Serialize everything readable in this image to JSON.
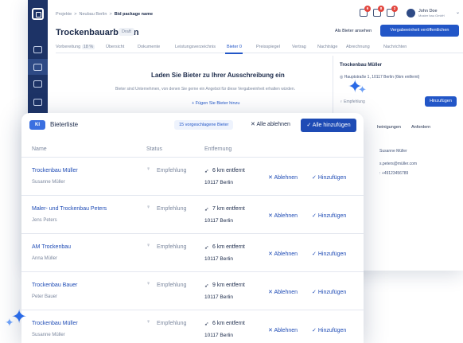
{
  "breadcrumb": {
    "root": "Projekte",
    "project": "Neubau Berlin",
    "current": "Bid package name",
    "sep": ">"
  },
  "page": {
    "title": "Trockenbauarbeiten",
    "status": "Draft"
  },
  "header": {
    "badges": [
      "6",
      "8",
      "2"
    ],
    "user_name": "John Doe",
    "user_company": "Muster bau GmbH",
    "view_as_bidder": "Als Bieter ansehen",
    "publish": "Vergabeeinheit veröffentlichen"
  },
  "tabs": [
    {
      "label": "Vorbereitung",
      "extra": "18 %"
    },
    {
      "label": "Übersicht"
    },
    {
      "label": "Dokumente"
    },
    {
      "label": "Leistungsverzeichnis"
    },
    {
      "label": "Bieter",
      "extra": "0",
      "active": true
    },
    {
      "label": "Preisspiegel"
    },
    {
      "label": "Vertrag"
    },
    {
      "label": "Nachträge"
    },
    {
      "label": "Abrechnung"
    },
    {
      "label": "Nachrichten"
    }
  ],
  "empty_state": {
    "title": "Laden Sie Bieter zu Ihrer Ausschreibung ein",
    "description": "Bieter sind Unternehmen, von denen Sie gerne ein Angebot für diese Vergabeeinheit erhalten würden.",
    "add_link": "+ Fügen Sie Bieter hinzu"
  },
  "side_panel": {
    "name": "Trockenbau Müller",
    "address": "Hauptstraße 1, 10117 Berlin (6km entfernt)",
    "recommendation": "Empfehlung",
    "add": "Hinzufügen",
    "tab_certificates": "heinigungen",
    "tab_request": "Anfordern",
    "contact_name": "Susanne Müller",
    "contact_email": "s.peters@müller.com",
    "contact_phone": ": +49123456789"
  },
  "card": {
    "ki_badge": "KI",
    "title": "Bieterliste",
    "suggested": "15 vorgeschlagene Bieter",
    "reject_all": "Alle ablehnen",
    "add_all": "Alle hinzufügen",
    "columns": [
      "Name",
      "Status",
      "Entfernung"
    ],
    "rows": [
      {
        "company": "Trockenbau Müller",
        "person": "Susanne Müller",
        "status": "Empfehlung",
        "distance": "6 km entfernt",
        "city": "10117 Berlin"
      },
      {
        "company": "Maler- und Trockenbau Peters",
        "person": "Jens Peters",
        "status": "Empfehlung",
        "distance": "7 km entfernt",
        "city": "10117 Berlin"
      },
      {
        "company": "AM Trockenbau",
        "person": "Anna Müller",
        "status": "Empfehlung",
        "distance": "6 km entfernt",
        "city": "10117 Berlin"
      },
      {
        "company": "Trockenbau Bauer",
        "person": "Peter Bauer",
        "status": "Empfehlung",
        "distance": "9 km entfernt",
        "city": "10117 Berlin"
      },
      {
        "company": "Trockenbau Müller",
        "person": "Susanne Müller",
        "status": "Empfehlung",
        "distance": "6 km entfernt",
        "city": "10117 Berlin"
      }
    ],
    "reject_label": "Ablehnen",
    "accept_label": "Hinzufügen"
  },
  "icons": {
    "reject": "✕",
    "accept": "✓",
    "location": "navigation-arrow-icon",
    "status": "lightbulb-icon"
  },
  "colors": {
    "primary": "#2256c7",
    "navy": "#1d3366",
    "accent_star": "#2a6ae6"
  }
}
